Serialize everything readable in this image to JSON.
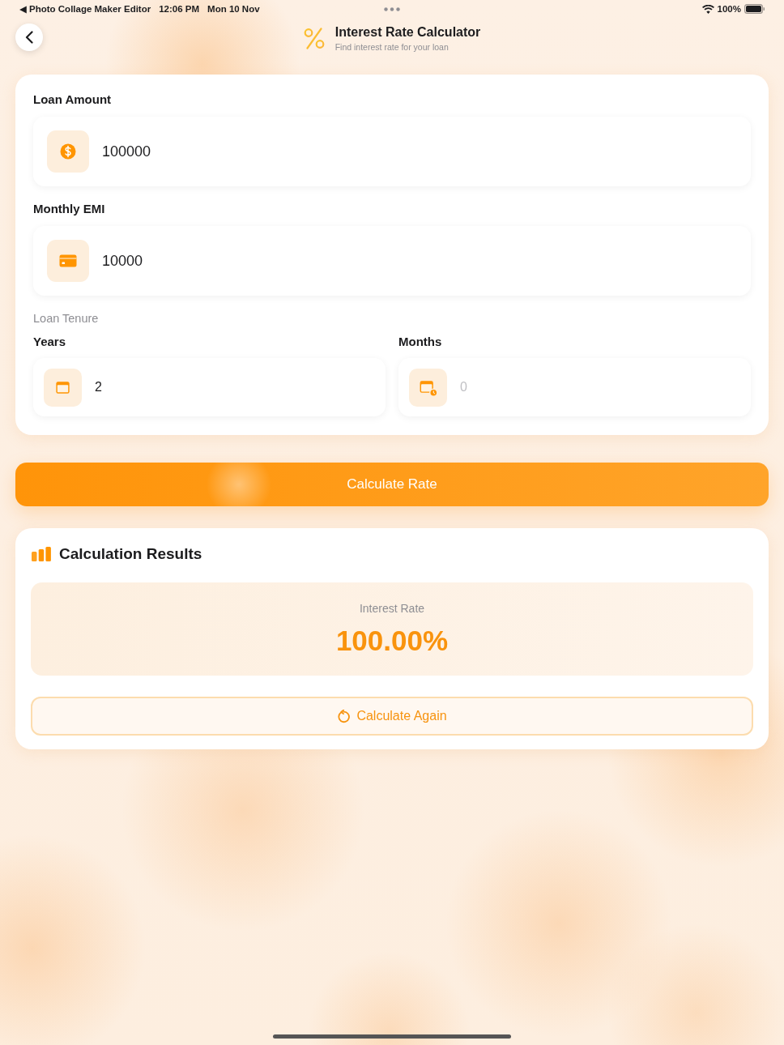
{
  "status_bar": {
    "back_link": "◀ Photo Collage Maker Editor",
    "time": "12:06 PM",
    "date": "Mon 10 Nov",
    "battery": "100%"
  },
  "header": {
    "title": "Interest Rate Calculator",
    "subtitle": "Find interest rate for your loan"
  },
  "form": {
    "fields": [
      {
        "kind": "amount",
        "label": "Loan Amount",
        "value": "100000"
      },
      {
        "kind": "card",
        "label": "Monthly EMI",
        "value": "10000"
      }
    ],
    "tenure": {
      "label": "Loan Tenure",
      "fields": [
        {
          "kind": "calendar",
          "label": "Years",
          "value": "2"
        },
        {
          "kind": "calendar_badge",
          "label": "Months",
          "placeholder": "0"
        }
      ]
    }
  },
  "calculate_button": {
    "label": "Calculate Rate"
  },
  "results": {
    "title": "Calculation Results",
    "rate_label": "Interest Rate",
    "rate_value": "100.00%",
    "again_button": {
      "label": "Calculate Again"
    }
  }
}
